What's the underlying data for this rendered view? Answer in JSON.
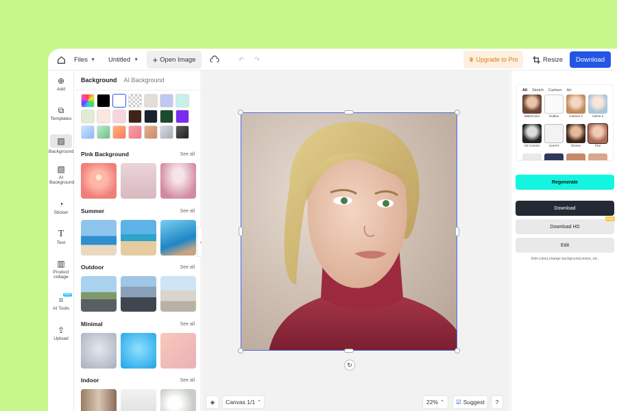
{
  "topbar": {
    "files_label": "Files",
    "doc_name": "Untitled",
    "open_image_label": "Open Image",
    "upgrade_label": "Upgrade to Pro",
    "resize_label": "Resize",
    "download_label": "Download"
  },
  "rail": {
    "items": [
      {
        "label": "Add",
        "icon": "plus-circle-icon"
      },
      {
        "label": "Templates",
        "icon": "templates-icon"
      },
      {
        "label": "Background",
        "icon": "background-icon",
        "active": true
      },
      {
        "label": "AI Background",
        "icon": "ai-background-icon"
      },
      {
        "label": "Sticker",
        "icon": "sticker-icon"
      },
      {
        "label": "Text",
        "icon": "text-icon"
      },
      {
        "label": "Product collage",
        "icon": "collage-icon"
      },
      {
        "label": "AI Tools",
        "icon": "ai-tools-icon",
        "badge": "New"
      },
      {
        "label": "Upload",
        "icon": "upload-icon"
      }
    ]
  },
  "panel": {
    "tab_background": "Background",
    "tab_ai_background": "AI Background",
    "see_all": "See all",
    "sections": [
      {
        "title": "Pink Background"
      },
      {
        "title": "Summer"
      },
      {
        "title": "Outdoor"
      },
      {
        "title": "Minimal"
      },
      {
        "title": "Indoor"
      }
    ]
  },
  "canvas": {
    "page_label": "Canvas 1/1",
    "zoom": "22%",
    "suggest_label": "Suggest",
    "help_label": "?"
  },
  "right_panel": {
    "style_tabs": [
      "All",
      "Sketch",
      "Cartoon",
      "Art"
    ],
    "styles": [
      "WaterColor",
      "Outline",
      "Cartoon 2",
      "Anime 2",
      "US Comics",
      "LineArt",
      "Disney",
      "PS2"
    ],
    "regenerate_label": "Regenerate",
    "download_label": "Download",
    "download_hd_label": "Download HD",
    "pro_badge": "PRO",
    "edit_label": "Edit",
    "hint": "Edit cutout,change background,resize, etc."
  },
  "colors": {
    "accent": "#2456e6",
    "regenerate": "#13f5e0",
    "page_bg": "#c7f68a"
  }
}
